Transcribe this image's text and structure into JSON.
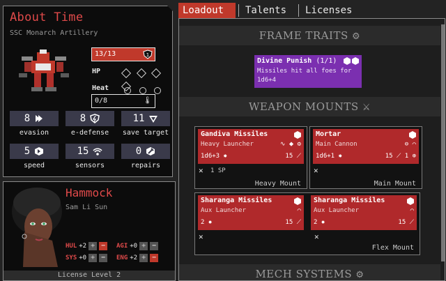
{
  "mech": {
    "name": "About Time",
    "frame": "SSC Monarch Artillery",
    "hp": {
      "label": "HP",
      "current": "13/13",
      "armor": "1"
    },
    "heat": {
      "label": "Heat",
      "value": "0/8"
    },
    "stats": [
      {
        "value": "8",
        "label": "evasion",
        "icon": "evasion-icon"
      },
      {
        "value": "8",
        "label": "e-defense",
        "icon": "e-defense-icon"
      },
      {
        "value": "11",
        "label": "save target",
        "icon": "save-target-icon"
      },
      {
        "value": "5",
        "label": "speed",
        "icon": "speed-icon"
      },
      {
        "value": "15",
        "label": "sensors",
        "icon": "sensors-icon"
      },
      {
        "value": "0",
        "label": "repairs",
        "icon": "repairs-icon"
      }
    ]
  },
  "pilot": {
    "callsign": "Hammock",
    "name": "Sam Li Sun",
    "skills": [
      {
        "label": "HUL",
        "value": "+2"
      },
      {
        "label": "AGI",
        "value": "+0"
      },
      {
        "label": "SYS",
        "value": "+0"
      },
      {
        "label": "ENG",
        "value": "+2"
      }
    ],
    "license": "License Level 2"
  },
  "tabs": [
    "Loadout",
    "Talents",
    "Licenses"
  ],
  "sections": {
    "frame_traits": "FRAME TRAITS",
    "weapon_mounts": "WEAPON MOUNTS",
    "mech_systems": "MECH SYSTEMS"
  },
  "trait": {
    "name": "Divine Punish",
    "count": "(1/1)",
    "description": "Missiles hit all foes for 1d6+4"
  },
  "mounts": [
    {
      "label": "Heavy Mount",
      "sp": "1 SP",
      "weapons": [
        {
          "name": "Gandiva Missiles",
          "type": "Heavy Launcher",
          "damage": "1d6+3",
          "range": "15"
        }
      ]
    },
    {
      "label": "Main Mount",
      "sp": "",
      "weapons": [
        {
          "name": "Mortar",
          "type": "Main Cannon",
          "damage": "1d6+1",
          "range": "15",
          "extra": "1"
        }
      ]
    },
    {
      "label": "Flex Mount",
      "sp": "",
      "weapons": [
        {
          "name": "Sharanga Missiles",
          "type": "Aux Launcher",
          "damage": "2",
          "range": "15"
        },
        {
          "name": "Sharanga Missiles",
          "type": "Aux Launcher",
          "damage": "2",
          "range": "15"
        }
      ]
    }
  ],
  "colors": {
    "accent_red": "#c0392b",
    "title_red": "#e04a4a",
    "trait_purple": "#7b2fb0",
    "stat_box": "#3a3a4a"
  }
}
